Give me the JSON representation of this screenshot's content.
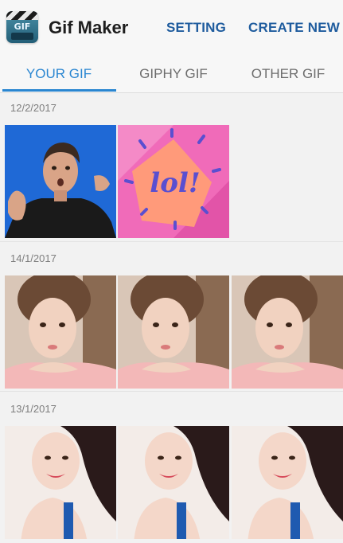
{
  "app": {
    "title": "Gif Maker",
    "icon_text": "GIF"
  },
  "actions": {
    "setting": "SETTING",
    "create_new": "CREATE NEW"
  },
  "tabs": [
    {
      "label": "YOUR GIF",
      "active": true
    },
    {
      "label": "GIPHY GIF",
      "active": false
    },
    {
      "label": "OTHER GIF",
      "active": false
    }
  ],
  "sections": [
    {
      "date": "12/2/2017",
      "items": [
        "man-surprised",
        "lol-sticker"
      ]
    },
    {
      "date": "14/1/2017",
      "items": [
        "woman-chin-on-hand",
        "woman-chin-on-hand",
        "woman-chin-on-hand"
      ]
    },
    {
      "date": "13/1/2017",
      "items": [
        "woman-smiling-blue-top",
        "woman-smiling-blue-top",
        "woman-smiling-blue-top"
      ]
    }
  ],
  "sticker": {
    "text": "lol!"
  },
  "colors": {
    "accent": "#2a86d1",
    "action": "#1f5c9e",
    "sticker_bg": "#f06bb9",
    "sticker_text": "#5a4fd0"
  }
}
